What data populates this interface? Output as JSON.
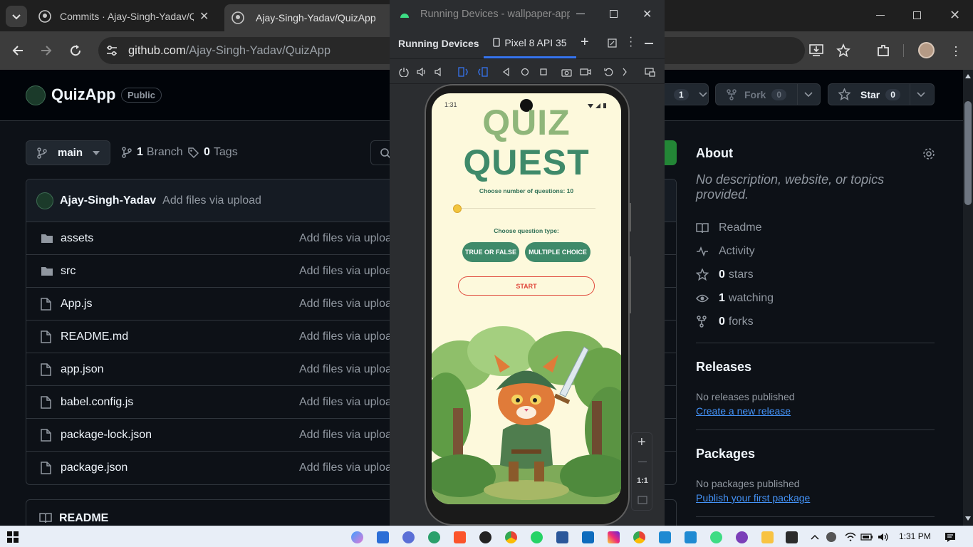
{
  "browser": {
    "tabs": [
      {
        "title": "Commits · Ajay-Singh-Yadav/Qu"
      },
      {
        "title": "Ajay-Singh-Yadav/QuizApp"
      }
    ],
    "url_domain": "github.com",
    "url_path": "/Ajay-Singh-Yadav/QuizApp"
  },
  "repo": {
    "name": "QuizApp",
    "visibility": "Public",
    "watch_count": "1",
    "fork_label": "Fork",
    "fork_count": "0",
    "star_label": "Star",
    "star_count": "0",
    "branch": "main",
    "branches_count": "1",
    "branches_label": "Branch",
    "tags_count": "0",
    "tags_label": "Tags"
  },
  "commit": {
    "author": "Ajay-Singh-Yadav",
    "message": "Add files via upload"
  },
  "files": [
    {
      "name": "assets",
      "type": "folder",
      "message": "Add files via uploa"
    },
    {
      "name": "src",
      "type": "folder",
      "message": "Add files via uploa"
    },
    {
      "name": "App.js",
      "type": "file",
      "message": "Add files via uploa"
    },
    {
      "name": "README.md",
      "type": "file",
      "message": "Add files via uploa"
    },
    {
      "name": "app.json",
      "type": "file",
      "message": "Add files via uploa"
    },
    {
      "name": "babel.config.js",
      "type": "file",
      "message": "Add files via uploa"
    },
    {
      "name": "package-lock.json",
      "type": "file",
      "message": "Add files via uploa"
    },
    {
      "name": "package.json",
      "type": "file",
      "message": "Add files via uploa"
    }
  ],
  "readme_label": "README",
  "about": {
    "heading": "About",
    "description": "No description, website, or topics provided.",
    "readme": "Readme",
    "activity": "Activity",
    "stars_count": "0",
    "stars_label": "stars",
    "watching_count": "1",
    "watching_label": "watching",
    "forks_count": "0",
    "forks_label": "forks"
  },
  "releases": {
    "heading": "Releases",
    "status": "No releases published",
    "link": "Create a new release"
  },
  "packages": {
    "heading": "Packages",
    "status": "No packages published",
    "link": "Publish your first package"
  },
  "emulator": {
    "window_title": "Running Devices - wallpaper-app",
    "panel_title": "Running Devices",
    "device_tab": "Pixel 8 API 35",
    "zoom_label": "1:1"
  },
  "phone": {
    "status_time": "1:31",
    "title_line1": "QUIZ",
    "title_line2": "QUEST",
    "questions_label": "Choose number of questions: 10",
    "questions_value": 10,
    "type_label": "Choose question type:",
    "btn_true_false": "TRUE OR FALSE",
    "btn_multiple": "MULTIPLE CHOICE",
    "btn_start": "START"
  },
  "taskbar": {
    "time": "1:31 PM"
  },
  "colors": {
    "gh_bg": "#0d1117",
    "link_blue": "#4493f8",
    "quiz_green": "#3f8a6a",
    "start_red": "#e0493c",
    "screen_bg": "#fdf9dc"
  }
}
